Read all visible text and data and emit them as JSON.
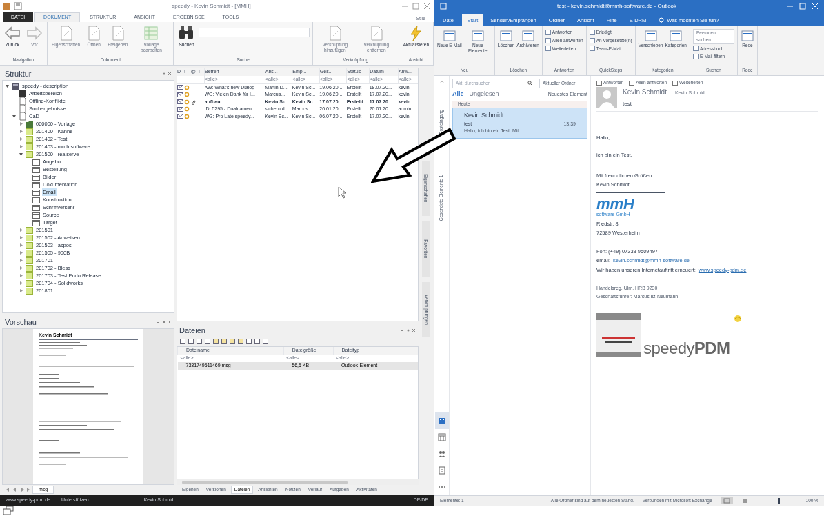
{
  "speedy": {
    "title": "speedy - Kevin Schmidt - [MMH]",
    "tabs": [
      {
        "label": "DATEI",
        "kind": "file",
        "selected": false
      },
      {
        "label": "DOKUMENT",
        "kind": "tab",
        "selected": true
      },
      {
        "label": "STRUKTUR",
        "kind": "tab",
        "selected": false
      },
      {
        "label": "ANSICHT",
        "kind": "tab",
        "selected": false
      },
      {
        "label": "ERGEBNISSE",
        "kind": "tab",
        "selected": false
      },
      {
        "label": "TOOLS",
        "kind": "tab",
        "selected": false
      }
    ],
    "style_label": "Stile",
    "ribbon_groups": [
      {
        "label": "Navigation",
        "buttons": [
          {
            "label": "Zurück",
            "kind": "back",
            "disabled": false
          },
          {
            "label": "Vor",
            "kind": "forward",
            "disabled": true
          }
        ]
      },
      {
        "label": "Dokument",
        "buttons": [
          {
            "label": "Eigenschaften",
            "kind": "doc",
            "disabled": true
          },
          {
            "label": "Öffnen",
            "kind": "doc",
            "disabled": true
          },
          {
            "label": "Freigeben",
            "kind": "doc",
            "disabled": true
          },
          {
            "label": "Vorlage bearbeiten",
            "kind": "sheet",
            "disabled": true
          }
        ]
      },
      {
        "label": "Suche",
        "search": true,
        "buttons": [
          {
            "label": "Suchen",
            "kind": "binoculars",
            "disabled": false
          }
        ]
      },
      {
        "label": "Verknüpfung",
        "buttons": [
          {
            "label": "Verknüpfung hinzufügen",
            "kind": "doc",
            "disabled": true
          },
          {
            "label": "Verknüpfung entfernen",
            "kind": "doc",
            "disabled": true
          }
        ]
      },
      {
        "label": "Ansicht",
        "buttons": [
          {
            "label": "Aktualisieren",
            "kind": "bolt",
            "disabled": false
          }
        ]
      }
    ],
    "structure": {
      "title": "Struktur",
      "tree": [
        {
          "label": "speedy - description",
          "kind": "root",
          "expanded": true,
          "selected": false,
          "children": [
            {
              "label": "Arbeitsbereich",
              "kind": "workspace",
              "selected": false
            },
            {
              "label": "Offline-Konflikte",
              "kind": "page",
              "selected": false
            },
            {
              "label": "Suchergebnisse",
              "kind": "page",
              "selected": false
            },
            {
              "label": "CaD",
              "kind": "page",
              "expanded": true,
              "selected": false,
              "children": [
                {
                  "label": "000000 - Vorlage",
                  "kind": "template",
                  "expanded": false,
                  "selected": false
                },
                {
                  "label": "201400 - Kanne",
                  "kind": "project",
                  "expanded": false,
                  "selected": false
                },
                {
                  "label": "201402 - Test",
                  "kind": "project",
                  "expanded": false,
                  "selected": false
                },
                {
                  "label": "201403 - mmh software",
                  "kind": "project",
                  "expanded": false,
                  "selected": false
                },
                {
                  "label": "201500 - realserve",
                  "kind": "project",
                  "expanded": true,
                  "selected": false,
                  "children": [
                    {
                      "label": "Angebot",
                      "kind": "folder",
                      "selected": false
                    },
                    {
                      "label": "Bestellung",
                      "kind": "folder",
                      "selected": false
                    },
                    {
                      "label": "Bilder",
                      "kind": "folder",
                      "selected": false
                    },
                    {
                      "label": "Dokumentation",
                      "kind": "folder",
                      "selected": false
                    },
                    {
                      "label": "Email",
                      "kind": "folder",
                      "selected": true
                    },
                    {
                      "label": "Konstruktion",
                      "kind": "folder",
                      "selected": false
                    },
                    {
                      "label": "Schriftverkehr",
                      "kind": "folder",
                      "selected": false
                    },
                    {
                      "label": "Source",
                      "kind": "folder",
                      "selected": false
                    },
                    {
                      "label": "Target",
                      "kind": "folder",
                      "selected": false
                    }
                  ]
                },
                {
                  "label": "201501",
                  "kind": "project",
                  "expanded": false,
                  "selected": false
                },
                {
                  "label": "201502 - Anweisen",
                  "kind": "project",
                  "expanded": false,
                  "selected": false
                },
                {
                  "label": "201503 - aspos",
                  "kind": "project",
                  "expanded": false,
                  "selected": false
                },
                {
                  "label": "201505 - 900B",
                  "kind": "project",
                  "expanded": false,
                  "selected": false
                },
                {
                  "label": "201701",
                  "kind": "project",
                  "expanded": false,
                  "selected": false
                },
                {
                  "label": "201702 - Bless",
                  "kind": "project",
                  "expanded": false,
                  "selected": false
                },
                {
                  "label": "201703 - Test Endo Release",
                  "kind": "project",
                  "expanded": false,
                  "selected": false
                },
                {
                  "label": "201704 - Solidworks",
                  "kind": "project",
                  "expanded": false,
                  "selected": false
                },
                {
                  "label": "201801",
                  "kind": "project",
                  "expanded": false,
                  "selected": false
                }
              ]
            }
          ]
        }
      ]
    },
    "list": {
      "icon_columns": [
        "D",
        "!",
        "@",
        "T"
      ],
      "columns": [
        "Betreff",
        "Abs...",
        "Emp...",
        "Ges...",
        "Status",
        "Datum",
        "Anw..."
      ],
      "filters": [
        "<alle>",
        "<alle>",
        "<alle>",
        "<alle>",
        "<alle>",
        "<alle>",
        "<alle>"
      ],
      "rows": [
        {
          "unread": false,
          "attachment": false,
          "cells": [
            "AW: What's new Dialog",
            "Martin D...",
            "Kevin Sc...",
            "19.06.20...",
            "Erstellt",
            "18.07.20...",
            "kevin"
          ]
        },
        {
          "unread": false,
          "attachment": false,
          "cells": [
            "WG: Vielen Dank für I...",
            "Marcus...",
            "Kevin Sc...",
            "19.06.20...",
            "Erstellt",
            "17.07.20...",
            "kevin"
          ]
        },
        {
          "unread": true,
          "attachment": true,
          "cells": [
            "aufbau",
            "Kevin Sc...",
            "Kevin Sc...",
            "17.07.20...",
            "Erstellt",
            "17.07.20...",
            "kevin"
          ]
        },
        {
          "unread": false,
          "attachment": false,
          "cells": [
            "ID: 5295 - Dualnamen...",
            "sichern d...",
            "Marcus",
            "20.01.20...",
            "Erstellt",
            "20.01.20...",
            "admin"
          ]
        },
        {
          "unread": false,
          "attachment": false,
          "cells": [
            "WG: Pro Late speedy...",
            "Kevin Sc...",
            "Kevin Sc...",
            "06.07.20...",
            "Erstellt",
            "17.07.20...",
            "kevin"
          ]
        }
      ]
    },
    "side_tabs": [
      "Eigenschaften",
      "Favoriten",
      "Verknüpfungen"
    ],
    "preview": {
      "title": "Vorschau",
      "heading": "Kevin Schmidt",
      "tab": "msg"
    },
    "files": {
      "title": "Dateien",
      "columns": [
        "Dateiname",
        "Dateigröße",
        "Dateityp"
      ],
      "filters": [
        "<alle>",
        "<alle>",
        "<alle>"
      ],
      "rows": [
        {
          "selected": true,
          "cells": [
            "7331749511469.msg",
            "56,5 KB",
            "Outlook-Element"
          ]
        }
      ],
      "tabs": [
        {
          "label": "Eigenen",
          "selected": false
        },
        {
          "label": "Versionen",
          "selected": false
        },
        {
          "label": "Dateien",
          "selected": true
        },
        {
          "label": "Ansichten",
          "selected": false
        },
        {
          "label": "Notizen",
          "selected": false
        },
        {
          "label": "Verlauf",
          "selected": false
        },
        {
          "label": "Aufgaben",
          "selected": false
        },
        {
          "label": "Aktivitäten",
          "selected": false
        }
      ]
    },
    "status_bar": [
      "www.speedy-pdm.de",
      "Unterstützen",
      "Kevin Schmidt",
      "DE/DE"
    ]
  },
  "outlook": {
    "title": "test - kevin.schmidt@mmh-software.de - Outlook",
    "tabs": [
      {
        "label": "Datei",
        "selected": false
      },
      {
        "label": "Start",
        "selected": true
      },
      {
        "label": "Senden/Empfangen",
        "selected": false
      },
      {
        "label": "Ordner",
        "selected": false
      },
      {
        "label": "Ansicht",
        "selected": false
      },
      {
        "label": "Hilfe",
        "selected": false
      },
      {
        "label": "E-DRM",
        "selected": false
      }
    ],
    "tell_me": "Was möchten Sie tun?",
    "ribbon_groups": [
      {
        "label": "Neu",
        "buttons": [
          {
            "label": "Neue E-Mail",
            "kind": "large"
          },
          {
            "label": "Neue Elemente",
            "kind": "large"
          }
        ]
      },
      {
        "label": "Löschen",
        "buttons": [
          {
            "label": "Löschen",
            "kind": "large"
          },
          {
            "label": "Archivieren",
            "kind": "large"
          }
        ]
      },
      {
        "label": "Antworten",
        "buttons": [
          {
            "label": "Antworten",
            "kind": "small"
          },
          {
            "label": "Allen antworten",
            "kind": "small"
          },
          {
            "label": "Weiterleiten",
            "kind": "small"
          }
        ]
      },
      {
        "label": "QuickSteps",
        "buttons": [
          {
            "label": "Erledigt",
            "kind": "small"
          },
          {
            "label": "An Vorgesetzte(n)",
            "kind": "small"
          },
          {
            "label": "Team-E-Mail",
            "kind": "small"
          }
        ]
      },
      {
        "label": "Kategorien",
        "buttons": [
          {
            "label": "Verschieben",
            "kind": "large"
          },
          {
            "label": "Kategorien",
            "kind": "large"
          }
        ]
      },
      {
        "label": "Suchen",
        "buttons": [
          {
            "label": "Personen suchen",
            "kind": "field"
          },
          {
            "label": "Adressbuch",
            "kind": "small"
          },
          {
            "label": "E-Mail filtern",
            "kind": "small"
          }
        ]
      },
      {
        "label": "Rede",
        "buttons": [
          {
            "label": "Rede",
            "kind": "large"
          }
        ]
      }
    ],
    "folders": [
      "Posteingang",
      "Gesendete Elemente 1"
    ],
    "search": {
      "placeholder": "Akt. durchsuchen",
      "scope": "Aktueller Ordner"
    },
    "filters": [
      {
        "label": "Alle",
        "selected": true
      },
      {
        "label": "Ungelesen",
        "selected": false
      }
    ],
    "sort": "Neuestes Element",
    "group": "Heute",
    "messages": [
      {
        "sender": "Kevin Schmidt",
        "subject": "test",
        "time": "13:39",
        "snippet": "Hallo, ich bin ein Test. Mit",
        "selected": true
      }
    ],
    "nav_icons": [
      {
        "kind": "mail",
        "selected": true
      },
      {
        "kind": "calendar",
        "selected": false
      },
      {
        "kind": "people",
        "selected": false
      },
      {
        "kind": "tasks",
        "selected": false
      },
      {
        "kind": "more",
        "selected": false
      }
    ],
    "reading": {
      "actions": [
        "Antworten",
        "Allen antworten",
        "Weiterleiten"
      ],
      "from": "Kevin Schmidt",
      "to": "Kevin Schmidt",
      "subject": "test",
      "body": [
        "Hallo,",
        "ich bin ein Test.",
        "Mit freundlichen Grüßen",
        "Kevin Schmidt"
      ],
      "logo": {
        "mark": "mmH",
        "sub": "software GmbH"
      },
      "address": [
        "Riedstr. 8",
        "72589 Westerheim"
      ],
      "contact": [
        {
          "kind": "text",
          "text": "Fon: (+49) 07333 9509497"
        },
        {
          "kind": "link",
          "text": "email:",
          "link": "kevin.schmidt@mmh-software.de"
        },
        {
          "kind": "link",
          "text": "Wir haben unseren Internetauftritt erneuert:",
          "link": "www.speedy-pdm.de"
        }
      ],
      "legal": [
        "Handelsreg. Ulm, HRB 9230",
        "Geschäftsführer: Marcus Ilz-Neumann"
      ],
      "product": "speedy**PDM**"
    },
    "status_bar": {
      "count": "Elemente: 1",
      "sync": "Alle Ordner sind auf dem neuesten Stand.",
      "connection": "Verbunden mit Microsoft Exchange",
      "zoom": "100 %",
      "zoom_slider": {
        "level": 0.55
      }
    }
  }
}
